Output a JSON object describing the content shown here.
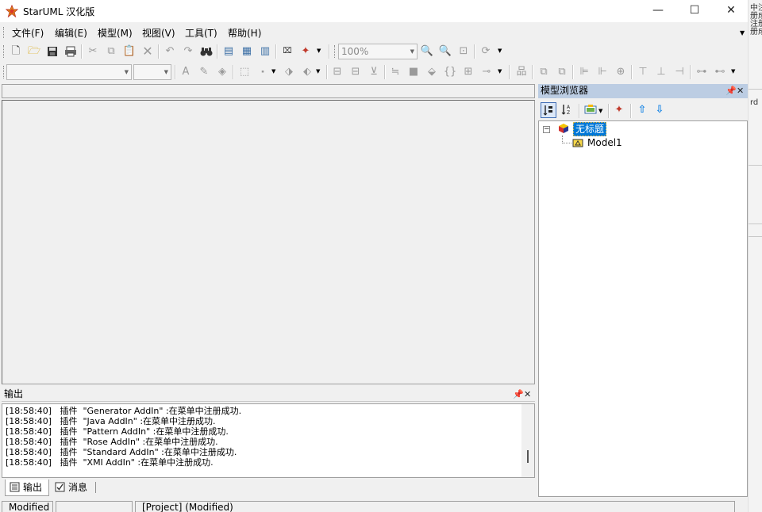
{
  "window": {
    "title": "StarUML 汉化版",
    "controls": {
      "minimize": "—",
      "maximize": "☐",
      "close": "✕"
    }
  },
  "menu": {
    "items": [
      {
        "label": "文件(F)"
      },
      {
        "label": "编辑(E)"
      },
      {
        "label": "模型(M)"
      },
      {
        "label": "视图(V)"
      },
      {
        "label": "工具(T)"
      },
      {
        "label": "帮助(H)"
      }
    ]
  },
  "toolbar": {
    "zoom_value": "100%"
  },
  "model_browser": {
    "title": "模型浏览器",
    "tree": [
      {
        "label": "无标题",
        "selected": true,
        "icon": "project-cube-icon"
      },
      {
        "label": "Model1",
        "icon": "model-folder-icon"
      }
    ]
  },
  "output": {
    "title": "输出",
    "lines": [
      "[18:58:40]   插件  \"Generator AddIn\" :在菜单中注册成功.",
      "[18:58:40]   插件  \"Java AddIn\" :在菜单中注册成功.",
      "[18:58:40]   插件  \"Pattern AddIn\" :在菜单中注册成功.",
      "[18:58:40]   插件  \"Rose AddIn\" :在菜单中注册成功.",
      "[18:58:40]   插件  \"Standard AddIn\" :在菜单中注册成功.",
      "[18:58:40]   插件  \"XMI AddIn\" :在菜单中注册成功."
    ],
    "tabs": [
      {
        "label": "输出",
        "active": true
      },
      {
        "label": "消息",
        "active": false
      }
    ]
  },
  "status": {
    "modified": "Modified",
    "project": "[Project]  (Modified)"
  },
  "background_window": {
    "texts": [
      "中注",
      "册成",
      "注册",
      "册成"
    ],
    "fragment": "rd"
  }
}
